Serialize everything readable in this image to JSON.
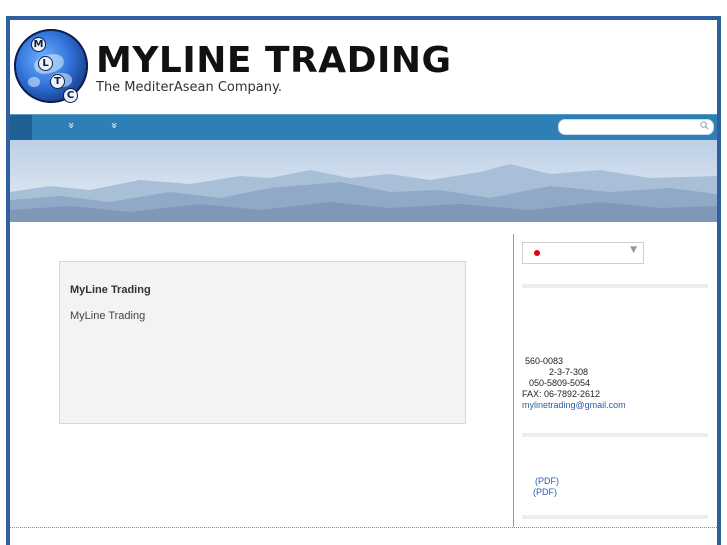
{
  "header": {
    "title": "MYLINE TRADING",
    "subtitle": "The MediterAsean Company.",
    "logo_letters": [
      "M",
      "L",
      "T",
      "C"
    ]
  },
  "nav": {
    "items": [
      "»",
      "»"
    ],
    "search_placeholder": ""
  },
  "main": {
    "card_title": "MyLine Trading",
    "card_text": "MyLine Trading"
  },
  "sidebar": {
    "language_icon": "japan-flag-icon",
    "contact": {
      "postal": "560-0083",
      "address": "2-3-7-308",
      "phone": "050-5809-5054",
      "fax": "FAX: 06-7892-2612",
      "email": "mylinetrading@gmail.com"
    },
    "pdf_links": [
      "(PDF)",
      "(PDF)"
    ]
  },
  "colors": {
    "nav_bar": "#2f7fb7",
    "frame": "#2f5f9e",
    "link": "#2b5ea8"
  }
}
